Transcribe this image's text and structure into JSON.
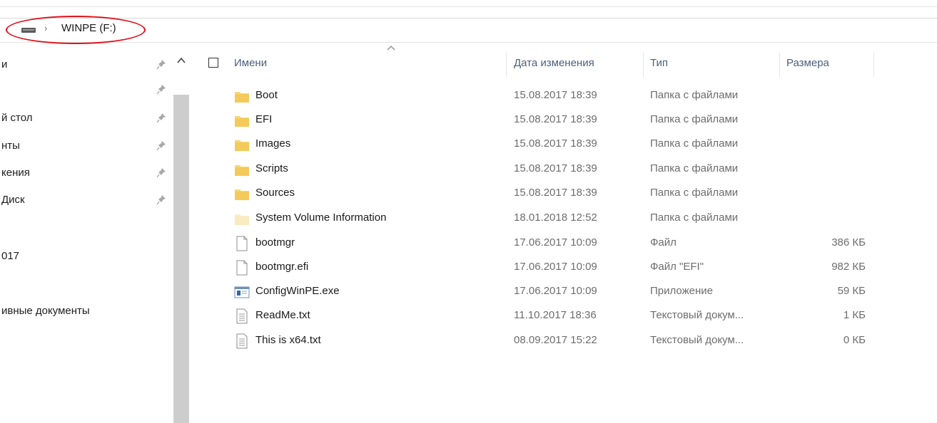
{
  "address": {
    "crumb": "WINPE (F:)"
  },
  "nav": {
    "items": [
      {
        "label": "и",
        "pinned": true
      },
      {
        "label": "",
        "pinned": true
      },
      {
        "label": "й стол",
        "pinned": true
      },
      {
        "label": "нты",
        "pinned": true
      },
      {
        "label": "кения",
        "pinned": true
      },
      {
        "label": "Диск",
        "pinned": true
      },
      {
        "label": "017",
        "pinned": false
      },
      {
        "label": "ивные документы",
        "pinned": false
      }
    ]
  },
  "columns": {
    "name": "Имени",
    "date": "Дата изменения",
    "type": "Тип",
    "size": "Размера"
  },
  "files": [
    {
      "name": "Boot",
      "date": "15.08.2017 18:39",
      "type": "Папка с файлами",
      "size": "",
      "icon": "folder-icon"
    },
    {
      "name": "EFI",
      "date": "15.08.2017 18:39",
      "type": "Папка с файлами",
      "size": "",
      "icon": "folder-icon"
    },
    {
      "name": "Images",
      "date": "15.08.2017 18:39",
      "type": "Папка с файлами",
      "size": "",
      "icon": "folder-icon"
    },
    {
      "name": "Scripts",
      "date": "15.08.2017 18:39",
      "type": "Папка с файлами",
      "size": "",
      "icon": "folder-icon"
    },
    {
      "name": "Sources",
      "date": "15.08.2017 18:39",
      "type": "Папка с файлами",
      "size": "",
      "icon": "folder-icon"
    },
    {
      "name": "System Volume Information",
      "date": "18.01.2018 12:52",
      "type": "Папка с файлами",
      "size": "",
      "icon": "hidden-folder-icon"
    },
    {
      "name": "bootmgr",
      "date": "17.06.2017 10:09",
      "type": "Файл",
      "size": "386 КБ",
      "icon": "file-icon"
    },
    {
      "name": "bootmgr.efi",
      "date": "17.06.2017 10:09",
      "type": "Файл \"EFI\"",
      "size": "982 КБ",
      "icon": "file-icon"
    },
    {
      "name": "ConfigWinPE.exe",
      "date": "17.06.2017 10:09",
      "type": "Приложение",
      "size": "59 КБ",
      "icon": "exe-icon"
    },
    {
      "name": "ReadMe.txt",
      "date": "11.10.2017 18:36",
      "type": "Текстовый докум...",
      "size": "1 КБ",
      "icon": "text-file-icon"
    },
    {
      "name": "This is x64.txt",
      "date": "08.09.2017 15:22",
      "type": "Текстовый докум...",
      "size": "0 КБ",
      "icon": "text-file-icon"
    }
  ],
  "colors": {
    "highlight_oval": "#e0101a",
    "folder": "#f8d775",
    "header_text": "#4c607a",
    "scrollbar": "#cdcdcd"
  }
}
